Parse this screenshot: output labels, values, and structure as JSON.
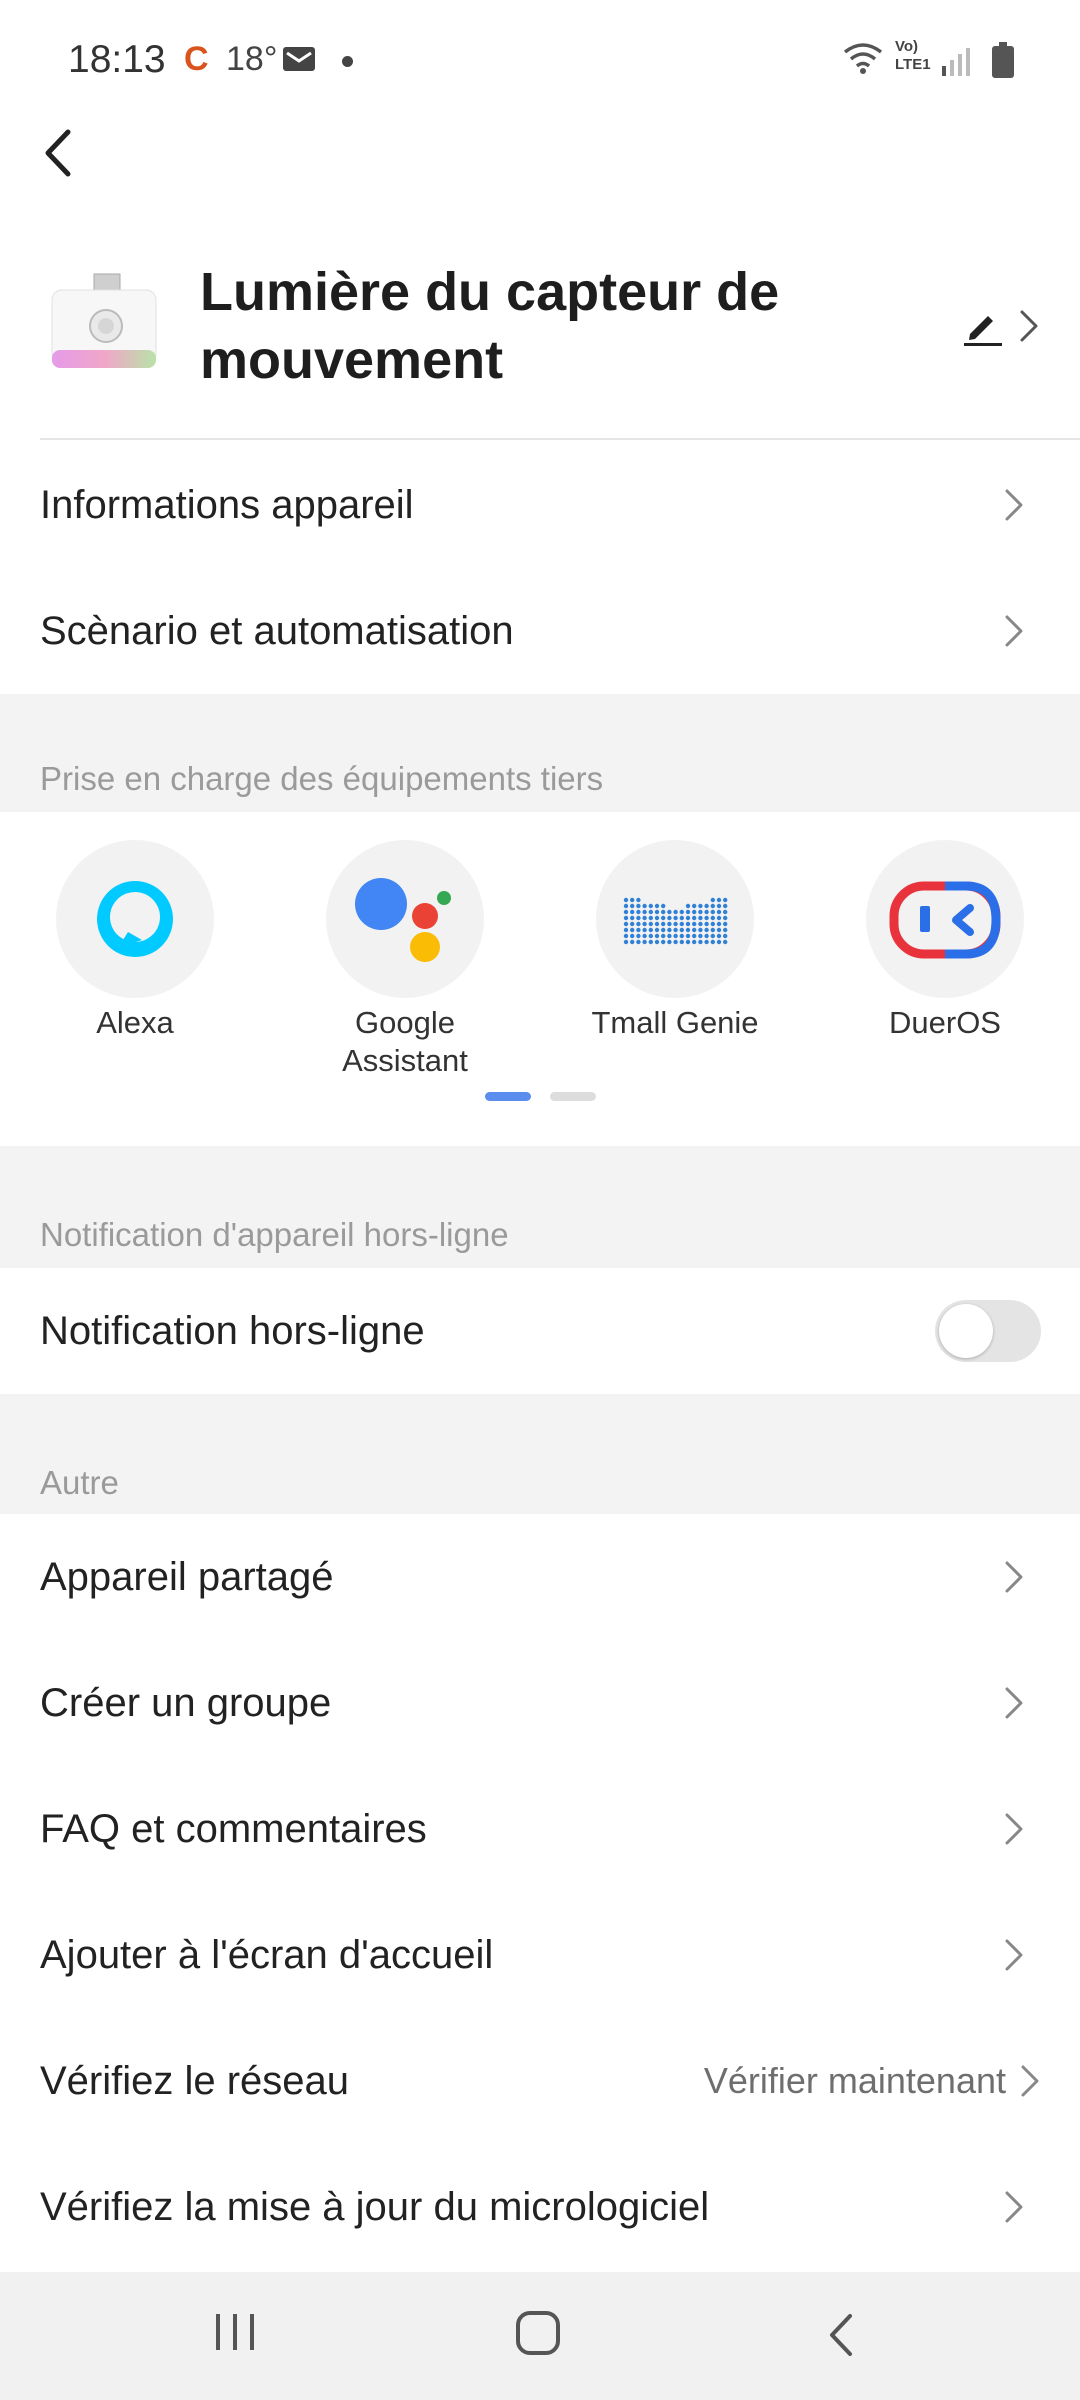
{
  "status_bar": {
    "time": "18:13",
    "carrier_icon": "C",
    "temperature": "18°",
    "network": "Vo) LTE1"
  },
  "header": {
    "device_name": "Lumière du capteur de mouvement"
  },
  "menu_top": [
    {
      "label": "Informations appareil"
    },
    {
      "label": "Scènario et automatisation"
    }
  ],
  "third_party": {
    "section_title": "Prise en charge des équipements tiers",
    "items": [
      {
        "label": "Alexa",
        "icon": "alexa-icon"
      },
      {
        "label": "Google Assistant",
        "icon": "google-assistant-icon"
      },
      {
        "label": "Tmall Genie",
        "icon": "tmall-genie-icon"
      },
      {
        "label": "DuerOS",
        "icon": "dueros-icon"
      }
    ],
    "page_count": 2,
    "active_page": 1
  },
  "offline": {
    "section_title": "Notification d'appareil hors-ligne",
    "label": "Notification hors-ligne",
    "enabled": false
  },
  "other": {
    "section_title": "Autre",
    "items": [
      {
        "label": "Appareil partagé"
      },
      {
        "label": "Créer un groupe"
      },
      {
        "label": "FAQ et commentaires"
      },
      {
        "label": "Ajouter à l'écran d'accueil"
      },
      {
        "label": "Vérifiez le réseau",
        "value": "Vérifier maintenant"
      },
      {
        "label": "Vérifiez la mise à jour du micrologiciel"
      }
    ]
  },
  "colors": {
    "accent": "#5b8def",
    "section_bg": "#f3f3f3",
    "alexa": "#00caff",
    "dueros_red": "#e8323c",
    "dueros_blue": "#2a6ee8"
  }
}
